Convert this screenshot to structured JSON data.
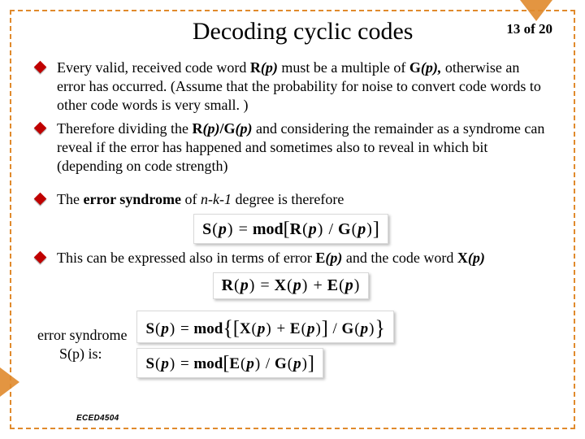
{
  "pager": "13 of 20",
  "title": "Decoding cyclic codes",
  "bullets": {
    "b1": {
      "t1": "Every valid, received code word ",
      "R": "R",
      "p1": "(p)",
      "t2": " must be a multiple of ",
      "G": "G",
      "p2": "(p),",
      "t3": " otherwise an error has occurred. (Assume that the probability for noise to convert code words to other code words is very small. )"
    },
    "b2": {
      "t1": "Therefore dividing the ",
      "RG": "R",
      "p1": "(p)",
      "slash": "/",
      "G": "G",
      "p2": "(p)",
      "t2": " and considering the remainder as a syndrome ",
      "mid": "can reveal if the error has happened",
      "t3": " and sometimes also to reveal in which bit (depending on code strength)"
    },
    "b3": {
      "t1": "The ",
      "es": "error syndrome",
      "t2": " of ",
      "deg": "n-k-1",
      "t3": " degree is therefore"
    },
    "b4": {
      "t1": "This can be expressed also ",
      "mid": "in terms of error ",
      "E": "E",
      "p1": "(p)",
      "t2": " and the code word ",
      "X": "X",
      "p2": "(p)"
    }
  },
  "eq1": {
    "lhs": "S",
    "lp": "(",
    "pv": "p",
    "rp": ")",
    "eq": " = ",
    "mod": "mod",
    "lR": "R",
    "lG": "G"
  },
  "eq2": {
    "lhs": "R",
    "X": "X",
    "E": "E",
    "p": "p",
    "plus": " + "
  },
  "eq3": {
    "lhs": "S",
    "X": "X",
    "E": "E",
    "G": "G",
    "p": "p",
    "mod": "mod"
  },
  "syndrome_label": "error syndrome\n      S(p) is:",
  "footer": "ECED4504"
}
